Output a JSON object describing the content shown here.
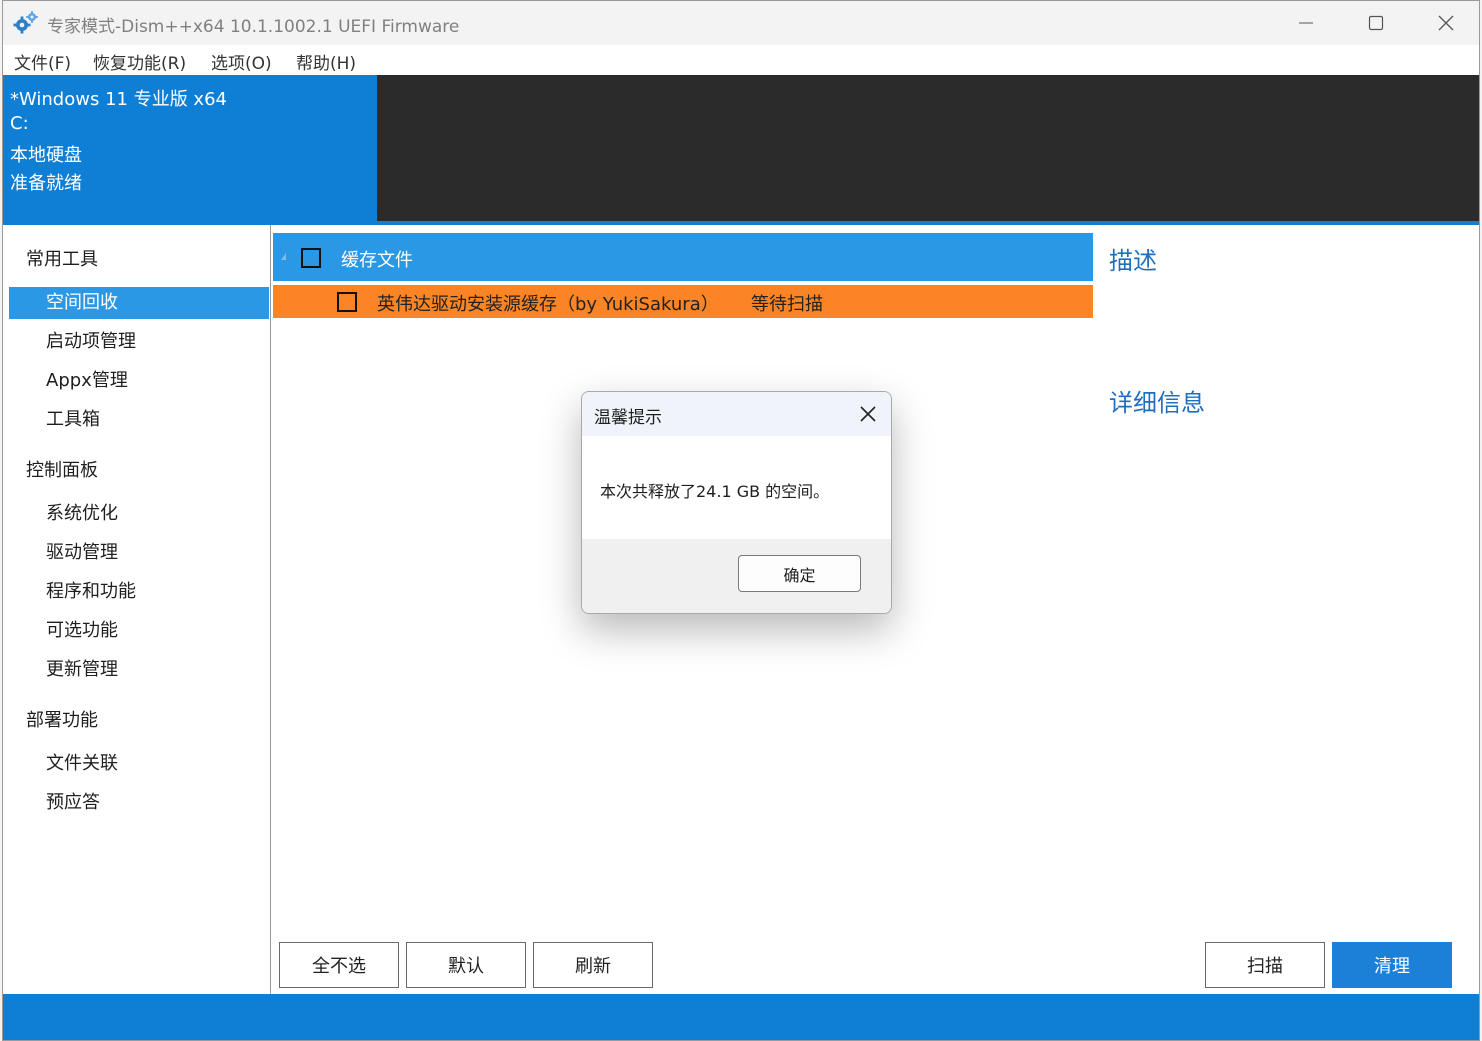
{
  "window": {
    "title": "专家模式-Dism++x64 10.1.1002.1 UEFI Firmware",
    "app_icon": "gears-icon",
    "controls": [
      "minimize-icon",
      "maximize-icon",
      "close-icon"
    ]
  },
  "menu": {
    "items": [
      {
        "label": "文件(F)"
      },
      {
        "label": "恢复功能(R)"
      },
      {
        "label": "选项(O)"
      },
      {
        "label": "帮助(H)"
      }
    ]
  },
  "system_info": {
    "os": "*Windows 11 专业版 x64",
    "drive": "C:",
    "disk_type": "本地硬盘",
    "status": "准备就绪"
  },
  "sidebar": {
    "groups": [
      {
        "label": "常用工具",
        "items": [
          {
            "label": "空间回收",
            "selected": true
          },
          {
            "label": "启动项管理"
          },
          {
            "label": "Appx管理"
          },
          {
            "label": "工具箱"
          }
        ]
      },
      {
        "label": "控制面板",
        "items": [
          {
            "label": "系统优化"
          },
          {
            "label": "驱动管理"
          },
          {
            "label": "程序和功能"
          },
          {
            "label": "可选功能"
          },
          {
            "label": "更新管理"
          }
        ]
      },
      {
        "label": "部署功能",
        "items": [
          {
            "label": "文件关联"
          },
          {
            "label": "预应答"
          }
        ]
      }
    ]
  },
  "cleanup_list": {
    "category": {
      "label": "缓存文件",
      "checked": false
    },
    "items": [
      {
        "label": "英伟达驱动安装源缓存（by YukiSakura）",
        "status": "等待扫描",
        "checked": false
      }
    ]
  },
  "right_panel": {
    "description_title": "描述",
    "details_title": "详细信息"
  },
  "buttons": {
    "select_none": "全不选",
    "default": "默认",
    "refresh": "刷新",
    "scan": "扫描",
    "clean": "清理"
  },
  "dialog": {
    "title": "温馨提示",
    "message": "本次共释放了24.1 GB 的空间。",
    "ok_label": "确定"
  },
  "colors": {
    "accent_blue": "#0f7fd6",
    "selection_blue": "#2b98e6",
    "highlight_orange": "#fb8424",
    "dark_panel": "#2b2b2b",
    "heading_blue": "#1f6fbf"
  }
}
